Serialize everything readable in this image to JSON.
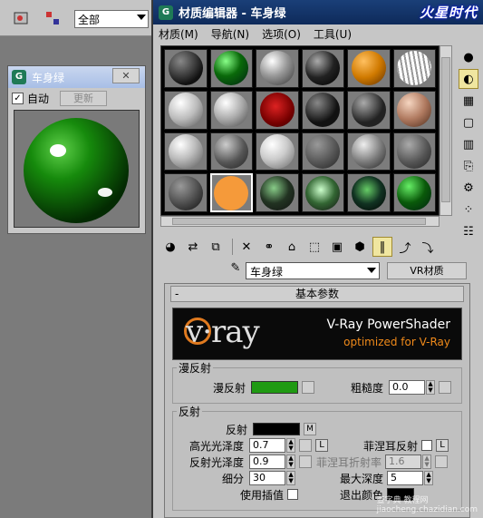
{
  "bg_toolbar": {
    "filter_value": "全部"
  },
  "render_window": {
    "title": "车身绿",
    "auto_label": "自动",
    "auto_checked": true,
    "update_label": "更新"
  },
  "editor": {
    "title": "材质编辑器 - 车身绿",
    "brand": "火星时代",
    "menus": [
      "材质(M)",
      "导航(N)",
      "选项(O)",
      "工具(U)"
    ],
    "material_name": "车身绿",
    "material_type": "VR材质",
    "rollout_title": "基本参数",
    "banner_line1": "V-Ray PowerShader",
    "banner_line2": "optimized for V-Ray",
    "vray_logo": "v·ray",
    "diffuse_group": "漫反射",
    "diffuse_label": "漫反射",
    "diffuse_color": "#1f9a12",
    "roughness_label": "粗糙度",
    "roughness_value": "0.0",
    "reflect_group": "反射",
    "reflect_label": "反射",
    "reflect_color": "#000000",
    "reflect_map": "M",
    "hilight_gloss_label": "高光光泽度",
    "hilight_gloss_value": "0.7",
    "hilight_lock": "L",
    "fresnel_label": "菲涅耳反射",
    "fresnel_lock": "L",
    "refl_gloss_label": "反射光泽度",
    "refl_gloss_value": "0.9",
    "fresnel_ior_label": "菲涅耳折射率",
    "fresnel_ior_value": "1.6",
    "subdivs_label": "细分",
    "subdivs_value": "30",
    "max_depth_label": "最大深度",
    "max_depth_value": "5",
    "use_interp_label": "使用插值",
    "exit_color_label": "退出颜色"
  },
  "watermark": "jiaocheng.chazidian.com",
  "watermark_brand": "查字典 教程网"
}
